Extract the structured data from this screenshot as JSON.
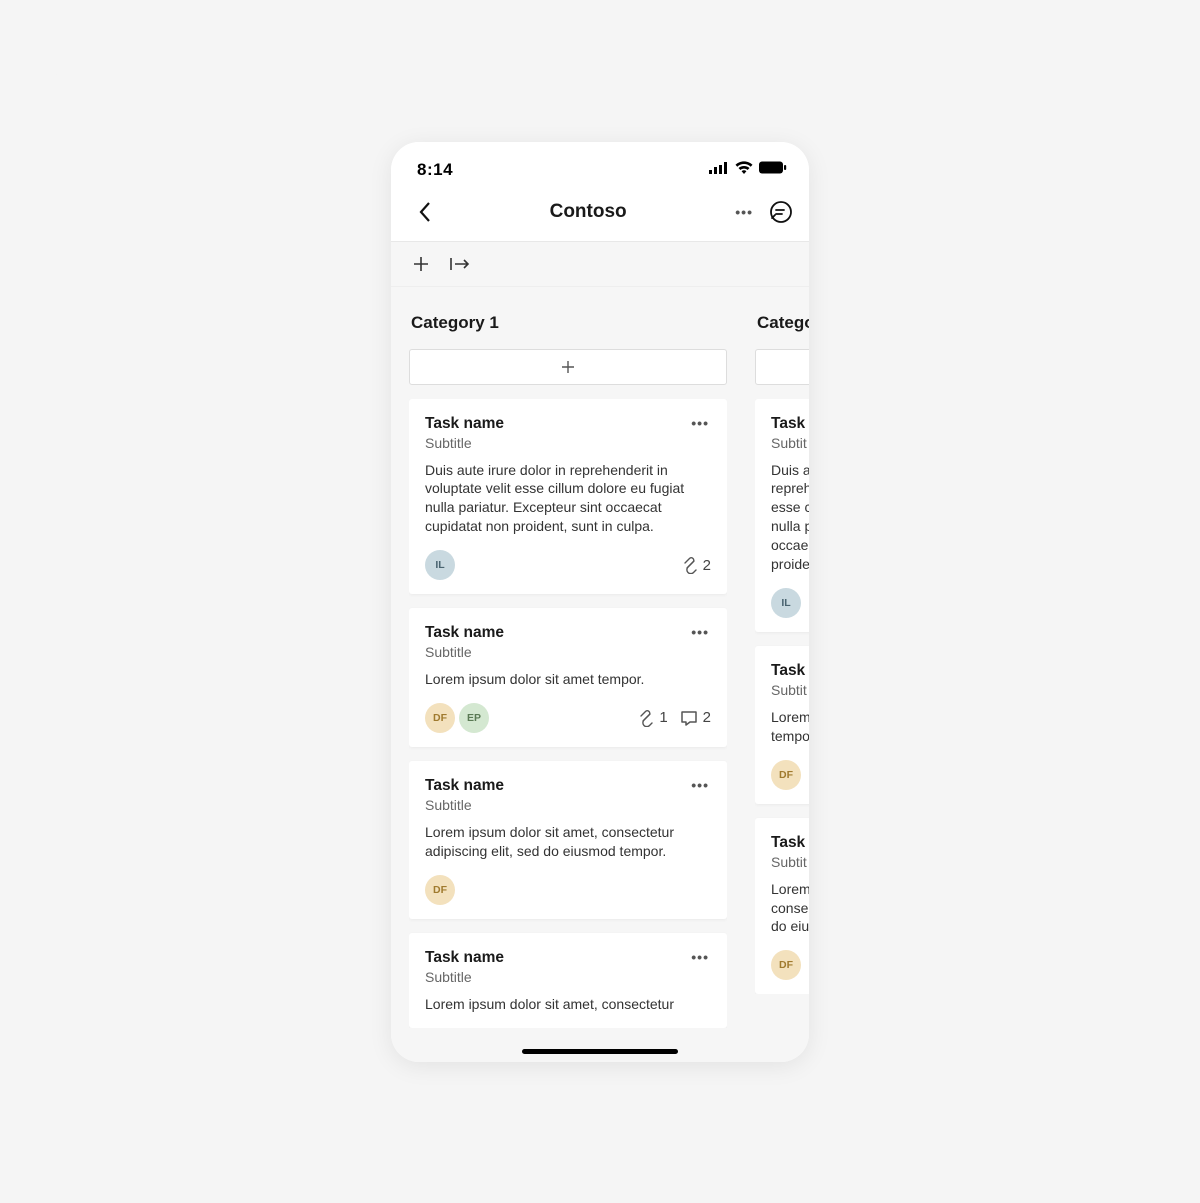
{
  "status": {
    "time": "8:14"
  },
  "header": {
    "title": "Contoso"
  },
  "columns": [
    {
      "title": "Category 1",
      "cards": [
        {
          "title": "Task name",
          "subtitle": "Subtitle",
          "desc": "Duis aute irure dolor in reprehenderit in voluptate velit esse cillum dolore eu fugiat nulla pariatur. Excepteur sint occaecat cupidatat non proident, sunt in culpa.",
          "assignees": [
            {
              "initials": "IL",
              "variant": "blue"
            }
          ],
          "attachments": "2",
          "comments": ""
        },
        {
          "title": "Task name",
          "subtitle": "Subtitle",
          "desc": "Lorem ipsum dolor sit amet tempor.",
          "assignees": [
            {
              "initials": "DF",
              "variant": "tan"
            },
            {
              "initials": "EP",
              "variant": "green"
            }
          ],
          "attachments": "1",
          "comments": "2"
        },
        {
          "title": "Task name",
          "subtitle": "Subtitle",
          "desc": "Lorem ipsum dolor sit amet, consectetur adipiscing elit, sed do eiusmod tempor.",
          "assignees": [
            {
              "initials": "DF",
              "variant": "tan"
            }
          ],
          "attachments": "",
          "comments": ""
        },
        {
          "title": "Task name",
          "subtitle": "Subtitle",
          "desc": "Lorem ipsum dolor sit amet, consectetur",
          "assignees": [],
          "attachments": "",
          "comments": ""
        }
      ]
    },
    {
      "title": "Catego",
      "cards": [
        {
          "title": "Task",
          "subtitle": "Subtit",
          "desc": "Duis a reprehe esse c nulla p occaec proide",
          "assignees": [
            {
              "initials": "IL",
              "variant": "blue"
            }
          ],
          "attachments": "",
          "comments": ""
        },
        {
          "title": "Task",
          "subtitle": "Subtit",
          "desc": "Lorem tempo",
          "assignees": [
            {
              "initials": "DF",
              "variant": "tan"
            }
          ],
          "attachments": "",
          "comments": ""
        },
        {
          "title": "Task",
          "subtitle": "Subtit",
          "desc": "Lorem conse do eiu",
          "assignees": [
            {
              "initials": "DF",
              "variant": "tan"
            }
          ],
          "attachments": "",
          "comments": ""
        }
      ]
    }
  ]
}
